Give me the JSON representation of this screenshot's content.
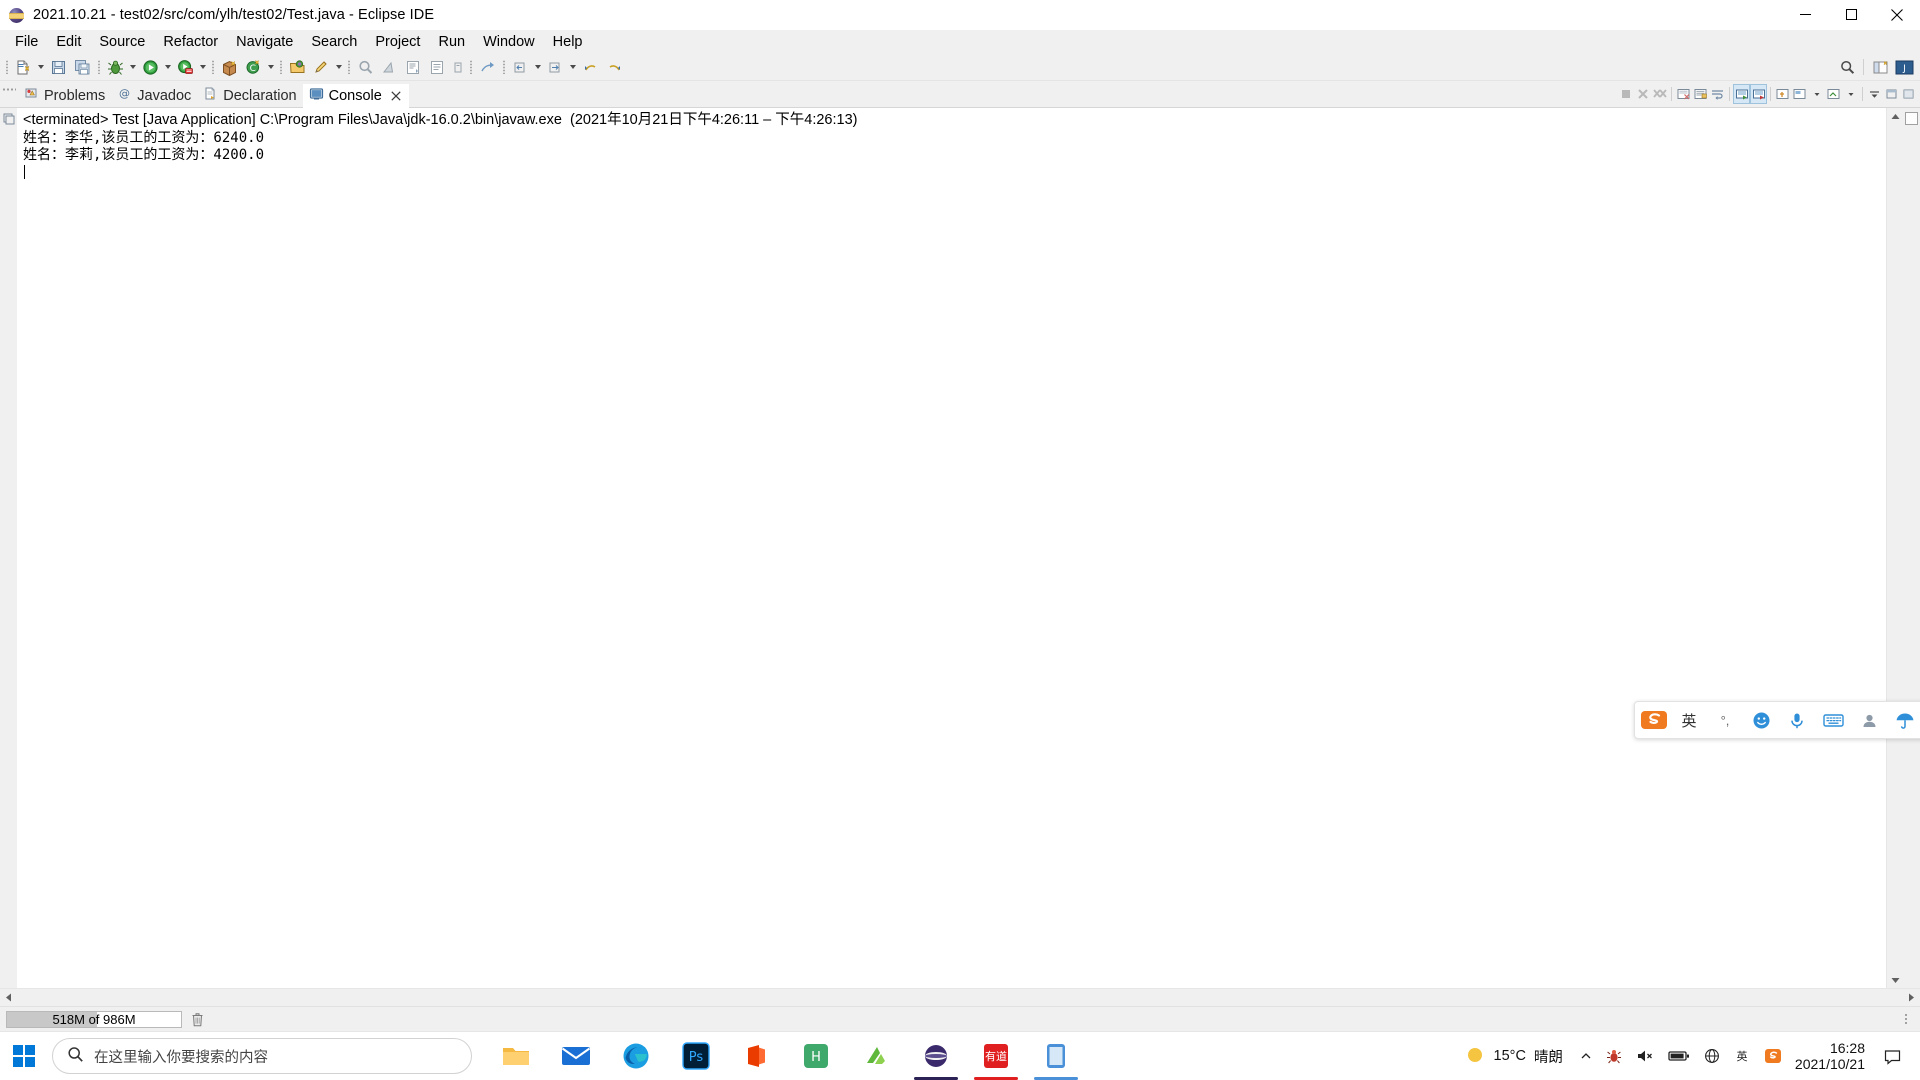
{
  "window": {
    "title": "2021.10.21 - test02/src/com/ylh/test02/Test.java - Eclipse IDE",
    "app_icon": "eclipse-icon",
    "minimize_label": "Minimize",
    "maximize_label": "Maximize",
    "close_label": "Close"
  },
  "menubar": {
    "items": [
      {
        "label": "File"
      },
      {
        "label": "Edit"
      },
      {
        "label": "Source"
      },
      {
        "label": "Refactor"
      },
      {
        "label": "Navigate"
      },
      {
        "label": "Search"
      },
      {
        "label": "Project"
      },
      {
        "label": "Run"
      },
      {
        "label": "Window"
      },
      {
        "label": "Help"
      }
    ]
  },
  "toolbar": {
    "buttons": [
      {
        "name": "new-icon",
        "tooltip": "New"
      },
      {
        "name": "save-icon",
        "tooltip": "Save"
      },
      {
        "name": "save-all-icon",
        "tooltip": "Save All"
      },
      {
        "name": "debug-icon",
        "tooltip": "Debug"
      },
      {
        "name": "run-icon",
        "tooltip": "Run"
      },
      {
        "name": "run-coverage-icon",
        "tooltip": "Coverage"
      },
      {
        "name": "new-java-package-icon",
        "tooltip": "New Java Package"
      },
      {
        "name": "new-class-icon",
        "tooltip": "New Java Class"
      },
      {
        "name": "open-type-icon",
        "tooltip": "Open Type"
      },
      {
        "name": "edit-icon",
        "tooltip": "Edit"
      },
      {
        "name": "search-icon",
        "tooltip": "Search"
      },
      {
        "name": "marker-icon",
        "tooltip": "Marker"
      },
      {
        "name": "toggle-breadcrumb-icon",
        "tooltip": "Toggle Breadcrumb"
      },
      {
        "name": "next-annotation-icon",
        "tooltip": "Next Annotation"
      },
      {
        "name": "previous-annotation-icon",
        "tooltip": "Previous Annotation"
      },
      {
        "name": "last-edit-location-icon",
        "tooltip": "Last Edit Location"
      },
      {
        "name": "back-icon",
        "tooltip": "Back"
      },
      {
        "name": "forward-icon",
        "tooltip": "Forward"
      },
      {
        "name": "pin-editor-icon",
        "tooltip": "Pin Editor"
      }
    ],
    "right_buttons": [
      {
        "name": "quick-access-search-icon",
        "tooltip": "Quick Access"
      },
      {
        "name": "open-perspective-icon",
        "tooltip": "Open Perspective"
      },
      {
        "name": "java-perspective-icon",
        "tooltip": "Java"
      }
    ]
  },
  "views": {
    "tabs": [
      {
        "label": "Problems",
        "icon": "problems-icon",
        "active": false,
        "closable": false
      },
      {
        "label": "Javadoc",
        "icon": "javadoc-at-icon",
        "active": false,
        "closable": false
      },
      {
        "label": "Declaration",
        "icon": "declaration-icon",
        "active": false,
        "closable": false
      },
      {
        "label": "Console",
        "icon": "console-icon",
        "active": true,
        "closable": true
      }
    ],
    "tab_tools": [
      {
        "name": "terminate-icon",
        "tooltip": "Terminate",
        "enabled": false
      },
      {
        "name": "remove-launch-icon",
        "tooltip": "Remove Launch",
        "enabled": false
      },
      {
        "name": "remove-all-terminated-icon",
        "tooltip": "Remove All Terminated Launches",
        "enabled": false
      },
      {
        "name": "clear-console-icon",
        "tooltip": "Clear Console",
        "enabled": true
      },
      {
        "name": "scroll-lock-icon",
        "tooltip": "Scroll Lock",
        "enabled": true
      },
      {
        "name": "word-wrap-icon",
        "tooltip": "Word Wrap",
        "enabled": true
      },
      {
        "name": "show-console-on-output-icon",
        "tooltip": "Show Console When Standard Out Changes",
        "enabled": true,
        "toggled": true
      },
      {
        "name": "show-console-on-error-icon",
        "tooltip": "Show Console When Standard Error Changes",
        "enabled": true,
        "toggled": true
      },
      {
        "name": "pin-console-icon",
        "tooltip": "Pin Console",
        "enabled": true
      },
      {
        "name": "display-selected-console-icon",
        "tooltip": "Display Selected Console",
        "enabled": true
      },
      {
        "name": "open-console-icon",
        "tooltip": "Open Console",
        "enabled": true
      },
      {
        "name": "view-menu-icon",
        "tooltip": "View Menu",
        "enabled": true
      },
      {
        "name": "minimize-view-icon",
        "tooltip": "Minimize",
        "enabled": true
      },
      {
        "name": "maximize-view-icon",
        "tooltip": "Maximize",
        "enabled": true
      }
    ]
  },
  "console": {
    "header": "<terminated> Test [Java Application] C:\\Program Files\\Java\\jdk-16.0.2\\bin\\javaw.exe  (2021年10月21日下午4:26:11 – 下午4:26:13)",
    "lines": [
      "姓名：李华,该员工的工资为：6240.0",
      "姓名：李莉,该员工的工资为：4200.0"
    ]
  },
  "statusbar": {
    "heap_label": "518M of 986M",
    "heap_percent": 52,
    "trash_tooltip": "Run Garbage Collector"
  },
  "ime": {
    "logo": "sogou-logo-icon",
    "mode_label": "英",
    "punct_label": "°,",
    "items": [
      {
        "name": "emoji-icon"
      },
      {
        "name": "microphone-icon"
      },
      {
        "name": "keyboard-icon"
      },
      {
        "name": "user-icon"
      },
      {
        "name": "umbrella-icon"
      },
      {
        "name": "app-grid-icon"
      }
    ]
  },
  "taskbar": {
    "start_label": "Start",
    "search_placeholder": "在这里输入你要搜索的内容",
    "search_icon": "search-icon",
    "apps": [
      {
        "name": "file-explorer-icon",
        "label": "File Explorer",
        "color": "#f6b93b",
        "active": false
      },
      {
        "name": "mail-icon",
        "label": "Mail",
        "color": "#1a6fd4",
        "active": false
      },
      {
        "name": "edge-icon",
        "label": "Microsoft Edge",
        "color": "#0b6ec6",
        "active": false
      },
      {
        "name": "photoshop-icon",
        "label": "Adobe Photoshop",
        "color": "#001e36",
        "active": false
      },
      {
        "name": "office-icon",
        "label": "Microsoft Office",
        "color": "#eb3c00",
        "active": false
      },
      {
        "name": "hbuilder-icon",
        "label": "HBuilder",
        "color": "#42b983",
        "active": false
      },
      {
        "name": "navicat-icon",
        "label": "Navicat",
        "color": "#69bd45",
        "active": false
      },
      {
        "name": "eclipse-icon",
        "label": "Eclipse IDE",
        "color": "#2c2255",
        "active": true
      },
      {
        "name": "youdao-icon",
        "label": "有道",
        "color": "#e02020",
        "active": true
      },
      {
        "name": "app-icon",
        "label": "App",
        "color": "#4a90d9",
        "active": true
      }
    ],
    "tray": {
      "weather_temp": "15°C",
      "weather_text": "晴朗",
      "chevron": "chevron-up-icon",
      "items": [
        {
          "name": "bug-tray-icon"
        },
        {
          "name": "volume-mute-icon"
        },
        {
          "name": "battery-icon"
        },
        {
          "name": "network-icon"
        },
        {
          "name": "ime-tray-icon"
        },
        {
          "name": "sogou-tray-icon"
        }
      ],
      "time": "16:28",
      "date": "2021/10/21",
      "show-desktop": "show-desktop-button"
    }
  }
}
